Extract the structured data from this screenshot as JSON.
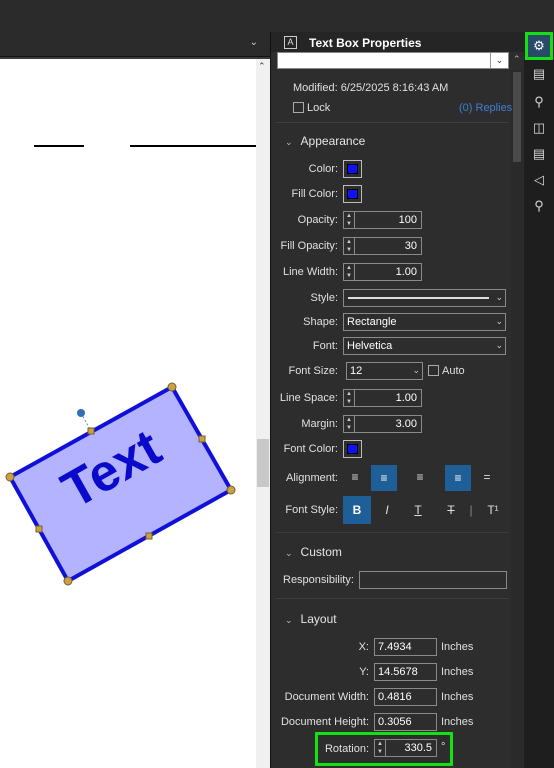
{
  "panel": {
    "title": "Text Box Properties",
    "modified": "Modified: 6/25/2025 8:16:43 AM",
    "lock_label": "Lock",
    "replies_link": "(0) Replies"
  },
  "appearance": {
    "header": "Appearance",
    "color_label": "Color:",
    "fill_color_label": "Fill Color:",
    "opacity_label": "Opacity:",
    "opacity_value": "100",
    "fill_opacity_label": "Fill Opacity:",
    "fill_opacity_value": "30",
    "line_width_label": "Line Width:",
    "line_width_value": "1.00",
    "style_label": "Style:",
    "shape_label": "Shape:",
    "shape_value": "Rectangle",
    "font_label": "Font:",
    "font_value": "Helvetica",
    "font_size_label": "Font Size:",
    "font_size_value": "12",
    "auto_label": "Auto",
    "line_space_label": "Line Space:",
    "line_space_value": "1.00",
    "margin_label": "Margin:",
    "margin_value": "3.00",
    "font_color_label": "Font Color:",
    "alignment_label": "Alignment:",
    "font_style_label": "Font Style:"
  },
  "custom": {
    "header": "Custom",
    "responsibility_label": "Responsibility:",
    "responsibility_value": ""
  },
  "layout": {
    "header": "Layout",
    "x_label": "X:",
    "x_value": "7.4934",
    "y_label": "Y:",
    "y_value": "14.5678",
    "doc_width_label": "Document Width:",
    "doc_width_value": "0.4816",
    "doc_height_label": "Document Height:",
    "doc_height_value": "0.3056",
    "rotation_label": "Rotation:",
    "rotation_value": "330.5",
    "unit": "Inches",
    "degree": "°"
  },
  "canvas": {
    "text_box_text": "Text",
    "stroke_color": "#1010d8",
    "fill_color": "#b3b3ff"
  },
  "colors": {
    "accent": "#1f5f97",
    "highlight": "#14e014",
    "swatch": "#1010ff"
  },
  "icons": {
    "rail": [
      "gear-icon",
      "ruler-icon",
      "map-pin-icon",
      "layers-icon",
      "stack-icon",
      "tag-icon",
      "search-icon"
    ]
  }
}
